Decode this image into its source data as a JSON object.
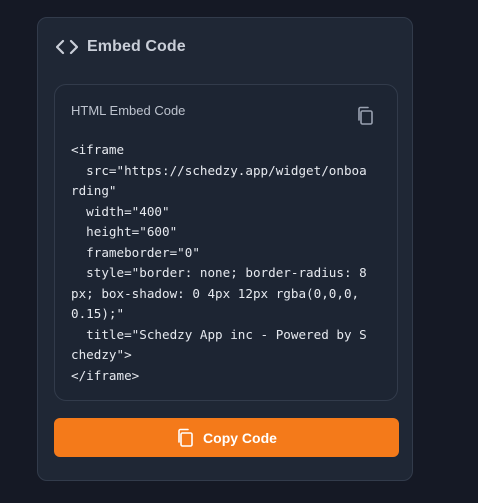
{
  "card": {
    "icon": "code-brackets-icon",
    "title": "Embed Code"
  },
  "code_box": {
    "label": "HTML Embed Code",
    "copy_icon": "copy-icon",
    "lines": [
      "<iframe",
      "  src=\"https://schedzy.app/widget/onboa",
      "rding\"",
      "  width=\"400\"",
      "  height=\"600\"",
      "  frameborder=\"0\"",
      "  style=\"border: none; border-radius: 8",
      "px; box-shadow: 0 4px 12px rgba(0,0,0,",
      "0.15);\"",
      "  title=\"Schedzy App inc - Powered by S",
      "chedzy\">",
      "</iframe>"
    ]
  },
  "copy_button": {
    "icon": "copy-icon",
    "label": "Copy Code"
  },
  "colors": {
    "background": "#151925",
    "card": "#1f2735",
    "accent": "#f47a1a"
  }
}
